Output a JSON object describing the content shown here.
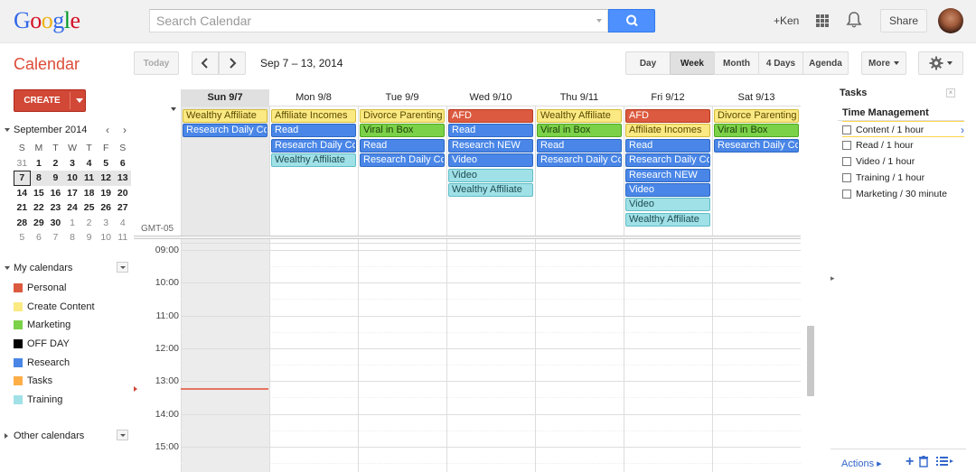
{
  "header": {
    "logo_letters": [
      "G",
      "o",
      "o",
      "g",
      "l",
      "e"
    ],
    "logo_colors": [
      "#3369e8",
      "#d50f25",
      "#eeb211",
      "#3369e8",
      "#009925",
      "#d50f25"
    ],
    "search_placeholder": "Search Calendar",
    "user_label": "+Ken",
    "share_label": "Share"
  },
  "toolbar": {
    "app_title": "Calendar",
    "today_label": "Today",
    "prev_icon": "chevron-left-icon",
    "next_icon": "chevron-right-icon",
    "date_range": "Sep 7 – 13, 2014",
    "views": [
      "Day",
      "Week",
      "Month",
      "4 Days",
      "Agenda"
    ],
    "selected_view": "Week",
    "more_label": "More",
    "settings_icon": "gear-icon"
  },
  "sidebar": {
    "create_label": "CREATE",
    "mini_cal": {
      "month_label": "September 2014",
      "dow": [
        "S",
        "M",
        "T",
        "W",
        "T",
        "F",
        "S"
      ],
      "weeks": [
        [
          "31",
          "1",
          "2",
          "3",
          "4",
          "5",
          "6"
        ],
        [
          "7",
          "8",
          "9",
          "10",
          "11",
          "12",
          "13"
        ],
        [
          "14",
          "15",
          "16",
          "17",
          "18",
          "19",
          "20"
        ],
        [
          "21",
          "22",
          "23",
          "24",
          "25",
          "26",
          "27"
        ],
        [
          "28",
          "29",
          "30",
          "1",
          "2",
          "3",
          "4"
        ],
        [
          "5",
          "6",
          "7",
          "8",
          "9",
          "10",
          "11"
        ]
      ]
    },
    "my_calendars_label": "My calendars",
    "calendars": [
      {
        "name": "Personal",
        "color": "#dc5a3f"
      },
      {
        "name": "Create Content",
        "color": "#fbe983"
      },
      {
        "name": "Marketing",
        "color": "#7bd148"
      },
      {
        "name": "OFF DAY",
        "color": "#000000"
      },
      {
        "name": "Research",
        "color": "#4986e7"
      },
      {
        "name": "Tasks",
        "color": "#ffad46"
      },
      {
        "name": "Training",
        "color": "#9fe1e7"
      }
    ],
    "other_calendars_label": "Other calendars"
  },
  "week": {
    "days": [
      "Sun 9/7",
      "Mon 9/8",
      "Tue 9/9",
      "Wed 9/10",
      "Thu 9/11",
      "Fri 9/12",
      "Sat 9/13"
    ],
    "today_index": 0,
    "timezone_label": "GMT-05",
    "hours": [
      "09:00",
      "10:00",
      "11:00",
      "12:00",
      "13:00",
      "14:00",
      "15:00"
    ],
    "allday_events": [
      [
        "Wealthy Affiliate",
        "Research Daily Cc"
      ],
      [
        "Affiliate Incomes",
        "Read",
        "Research Daily Cc",
        "Wealthy Affiliate"
      ],
      [
        "Divorce Parenting",
        "Viral in Box",
        "Read",
        "Research Daily Cc"
      ],
      [
        "AFD",
        "Read",
        "Research NEW",
        "Video",
        "Video",
        "Wealthy Affiliate"
      ],
      [
        "Wealthy Affiliate",
        "Viral in Box",
        "Read",
        "Research Daily Cc"
      ],
      [
        "AFD",
        "Affiliate Incomes",
        "Read",
        "Research Daily Cc",
        "Research NEW",
        "Video",
        "Video",
        "Wealthy Affiliate"
      ],
      [
        "Divorce Parenting",
        "Viral in Box",
        "Research Daily Cc"
      ]
    ],
    "allday_event_colors": [
      [
        "#fbe983",
        "#4986e7"
      ],
      [
        "#fbe983",
        "#4986e7",
        "#4986e7",
        "#9fe1e7"
      ],
      [
        "#fbe983",
        "#7bd148",
        "#4986e7",
        "#4986e7"
      ],
      [
        "#dc5a3f",
        "#4986e7",
        "#4986e7",
        "#4986e7",
        "#9fe1e7",
        "#9fe1e7"
      ],
      [
        "#fbe983",
        "#7bd148",
        "#4986e7",
        "#4986e7"
      ],
      [
        "#dc5a3f",
        "#fbe983",
        "#4986e7",
        "#4986e7",
        "#4986e7",
        "#4986e7",
        "#9fe1e7",
        "#9fe1e7"
      ],
      [
        "#fbe983",
        "#7bd148",
        "#4986e7"
      ]
    ]
  },
  "tasks": {
    "title": "Tasks",
    "list_name": "Time Management",
    "items": [
      "Content / 1 hour",
      "Read / 1 hour",
      "Video / 1 hour",
      "Training / 1 hour",
      "Marketing / 30 minute"
    ],
    "actions_label": "Actions ▸"
  }
}
